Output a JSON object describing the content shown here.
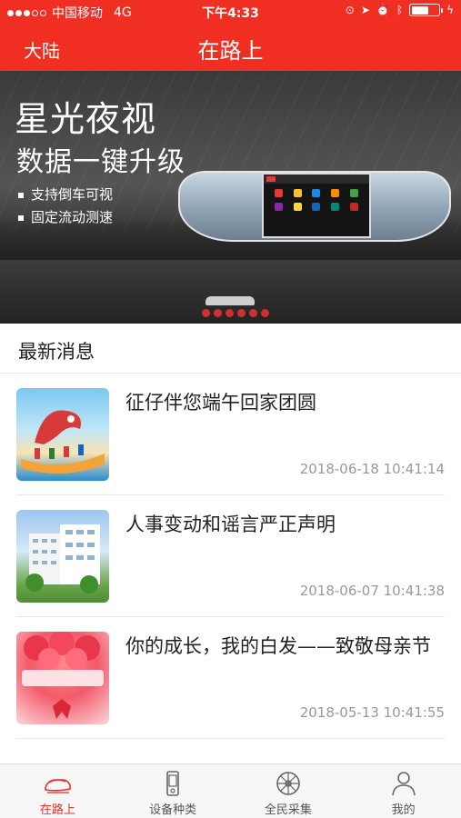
{
  "status_bar": {
    "carrier": "中国移动",
    "network": "4G",
    "time": "下午4:33",
    "battery_fraction": 0.62
  },
  "nav": {
    "left_label": "大陆",
    "title": "在路上"
  },
  "banner": {
    "title": "星光夜视",
    "subtitle": "数据一键升级",
    "bullets": [
      "支持倒车可视",
      "固定流动测速"
    ]
  },
  "news": {
    "section_title": "最新消息",
    "items": [
      {
        "title": "征仔伴您端午回家团圆",
        "date": "2018-06-18 10:41:14",
        "thumb_icon": "dragon-boat-image"
      },
      {
        "title": "人事变动和谣言严正声明",
        "date": "2018-06-07 10:41:38",
        "thumb_icon": "office-building-image"
      },
      {
        "title": "你的成长，我的白发——致敬母亲节",
        "date": "2018-05-13 10:41:55",
        "thumb_icon": "mothers-day-balloons-image"
      }
    ]
  },
  "tabs": [
    {
      "label": "在路上",
      "icon": "car-icon",
      "active": true
    },
    {
      "label": "设备种类",
      "icon": "device-icon",
      "active": false
    },
    {
      "label": "全民采集",
      "icon": "wheel-icon",
      "active": false
    },
    {
      "label": "我的",
      "icon": "person-icon",
      "active": false
    }
  ],
  "colors": {
    "brand": "#f02e22",
    "text": "#222222",
    "muted": "#999999"
  }
}
